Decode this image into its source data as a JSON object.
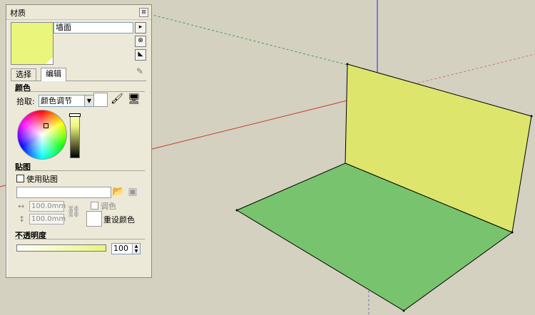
{
  "panel": {
    "title": "材质",
    "close_label": "⊠",
    "material_name": "墙面",
    "material_color": "#e9f57b",
    "tabs": [
      {
        "label": "选择"
      },
      {
        "label": "编辑"
      }
    ],
    "selected_tab": "编辑"
  },
  "color_section": {
    "heading": "颜色",
    "pick_label": "拾取:",
    "pick_mode": "颜色调节"
  },
  "texture_section": {
    "heading": "贴图",
    "use_texture_label": "使用贴图",
    "width_value": "100.0mm",
    "height_value": "100.0mm",
    "colorize_label": "调色",
    "reset_color_label": "重设颜色"
  },
  "opacity_section": {
    "heading": "不透明度",
    "value": "100"
  },
  "scene": {
    "background": "#d4d1c0",
    "wall_color": "#dde56d",
    "floor_color": "#78c36d"
  }
}
